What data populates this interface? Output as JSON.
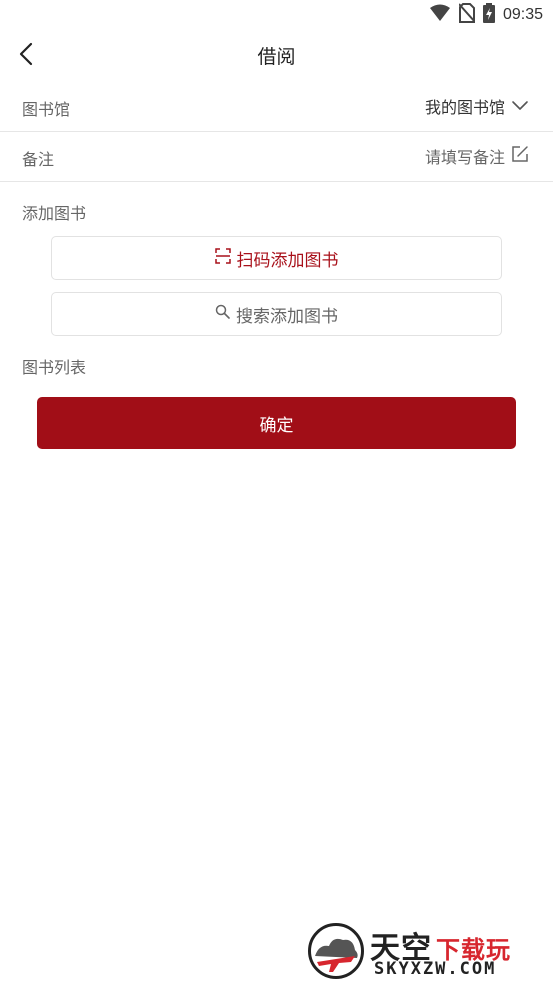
{
  "status_bar": {
    "time": "09:35",
    "icons": [
      "wifi-icon",
      "no-sim-icon",
      "battery-charging-icon"
    ]
  },
  "header": {
    "title": "借阅",
    "back_icon": "chevron-left-icon"
  },
  "form": {
    "library": {
      "label": "图书馆",
      "value": "我的图书馆",
      "icon": "chevron-down-icon"
    },
    "remark": {
      "label": "备注",
      "placeholder": "请填写备注",
      "icon": "edit-icon"
    }
  },
  "add_books": {
    "label": "添加图书",
    "scan_button": {
      "label": "扫码添加图书",
      "icon": "scan-icon"
    },
    "search_button": {
      "label": "搜索添加图书",
      "icon": "search-icon"
    }
  },
  "book_list": {
    "label": "图书列表"
  },
  "confirm_button": {
    "label": "确定"
  },
  "watermark": {
    "title": "天空",
    "subtitle": "下载玩",
    "domain": "SKYXZW.COM"
  },
  "colors": {
    "accent": "#a10e17",
    "scan_text": "#a8101a",
    "watermark_red": "#d7262e"
  }
}
